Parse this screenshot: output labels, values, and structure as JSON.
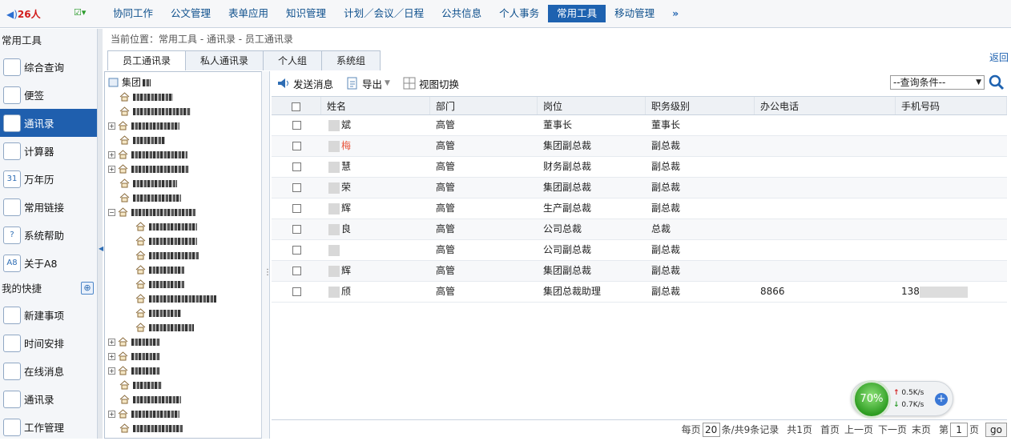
{
  "topbar": {
    "online_prefix": "◀)",
    "online_count": "26人",
    "menu": [
      "协同工作",
      "公文管理",
      "表单应用",
      "知识管理",
      "计划／会议／日程",
      "公共信息",
      "个人事务",
      "常用工具",
      "移动管理"
    ],
    "active_menu": "常用工具",
    "more": "»"
  },
  "leftnav": {
    "section1": "常用工具",
    "tools": [
      {
        "label": "综合查询",
        "icon": "search-doc-icon"
      },
      {
        "label": "便签",
        "icon": "note-icon"
      },
      {
        "label": "通讯录",
        "icon": "address-book-icon"
      },
      {
        "label": "计算器",
        "icon": "calculator-icon"
      },
      {
        "label": "万年历",
        "icon": "calendar-icon",
        "glyph": "31"
      },
      {
        "label": "常用链接",
        "icon": "link-icon"
      },
      {
        "label": "系统帮助",
        "icon": "help-icon",
        "glyph": "?"
      },
      {
        "label": "关于A8",
        "icon": "about-icon",
        "glyph": "A8"
      }
    ],
    "section2": "我的快捷",
    "shortcuts": [
      {
        "label": "新建事项",
        "icon": "new-item-icon"
      },
      {
        "label": "时间安排",
        "icon": "schedule-icon"
      },
      {
        "label": "在线消息",
        "icon": "message-icon"
      },
      {
        "label": "通讯录",
        "icon": "contacts-icon"
      },
      {
        "label": "工作管理",
        "icon": "work-icon"
      }
    ],
    "active": "通讯录"
  },
  "main": {
    "breadcrumb": "当前位置：常用工具 - 通讯录 - 员工通讯录",
    "tabs": [
      "员工通讯录",
      "私人通讯录",
      "个人组",
      "系统组"
    ],
    "active_tab": "员工通讯录",
    "back": "返回"
  },
  "tree": {
    "root": "集团"
  },
  "toolbar": {
    "send": "发送消息",
    "export": "导出",
    "switch": "视图切换",
    "query_placeholder": "--查询条件--"
  },
  "grid": {
    "headers": [
      "姓名",
      "部门",
      "岗位",
      "职务级别",
      "办公电话",
      "手机号码"
    ],
    "rows": [
      {
        "name_a": "",
        "name_b": "斌",
        "dept": "高管",
        "post": "董事长",
        "level": "董事长",
        "phone": "",
        "mobile": ""
      },
      {
        "name_a": "",
        "name_b": "梅",
        "dept": "高管",
        "post": "集团副总裁",
        "level": "副总裁",
        "phone": "",
        "mobile": ""
      },
      {
        "name_a": "",
        "name_b": "慧",
        "dept": "高管",
        "post": "财务副总裁",
        "level": "副总裁",
        "phone": "",
        "mobile": ""
      },
      {
        "name_a": "",
        "name_b": "荣",
        "dept": "高管",
        "post": "集团副总裁",
        "level": "副总裁",
        "phone": "",
        "mobile": ""
      },
      {
        "name_a": "",
        "name_b": "辉",
        "dept": "高管",
        "post": "生产副总裁",
        "level": "副总裁",
        "phone": "",
        "mobile": ""
      },
      {
        "name_a": "",
        "name_b": "良",
        "dept": "高管",
        "post": "公司总裁",
        "level": "总裁",
        "phone": "",
        "mobile": ""
      },
      {
        "name_a": "",
        "name_b": "",
        "dept": "高管",
        "post": "公司副总裁",
        "level": "副总裁",
        "phone": "",
        "mobile": ""
      },
      {
        "name_a": "",
        "name_b": "辉",
        "dept": "高管",
        "post": "集团副总裁",
        "level": "副总裁",
        "phone": "",
        "mobile": ""
      },
      {
        "name_a": "",
        "name_b": "颀",
        "dept": "高管",
        "post": "集团总裁助理",
        "level": "副总裁",
        "phone": "8866",
        "mobile": "138"
      }
    ]
  },
  "pager": {
    "per_page_label": "每页",
    "per_page": "20",
    "summary": "条/共9条记录",
    "total_pages": "共1页",
    "first": "首页",
    "prev": "上一页",
    "next": "下一页",
    "last": "末页",
    "page_label_a": "第",
    "page": "1",
    "page_label_b": "页",
    "go": "go"
  },
  "net": {
    "percent": "70%",
    "up": "0.5K/s",
    "down": "0.7K/s"
  }
}
